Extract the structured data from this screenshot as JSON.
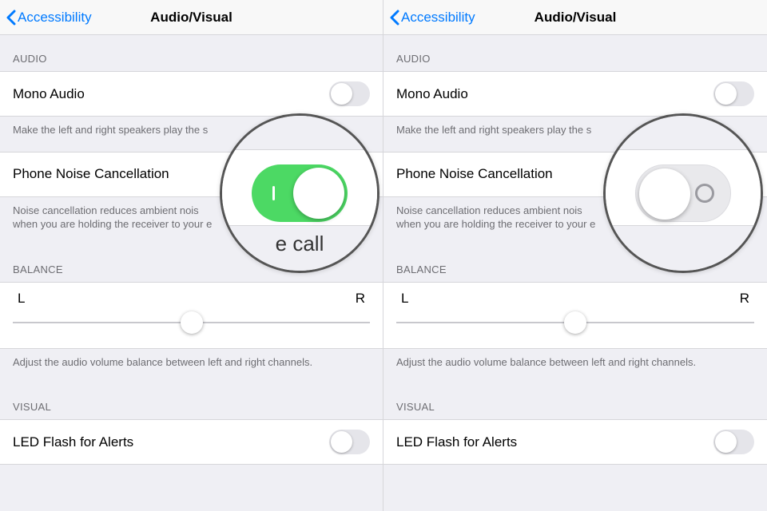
{
  "nav": {
    "back_label": "Accessibility",
    "title": "Audio/Visual"
  },
  "sections": {
    "audio_header": "AUDIO",
    "balance_header": "BALANCE",
    "visual_header": "VISUAL"
  },
  "rows": {
    "mono_audio": "Mono Audio",
    "phone_noise_cancellation": "Phone Noise Cancellation",
    "led_flash": "LED Flash for Alerts"
  },
  "footers": {
    "mono_audio_left": "Make the left and right speakers play the s",
    "noise_left_line1": "Noise cancellation reduces ambient nois",
    "noise_left_line2": "when you are holding the receiver to your e",
    "mono_audio_right": "Make the left and right speakers play the s",
    "noise_right_line1": "Noise cancellation reduces ambient nois",
    "noise_right_line2": "when you are holding the receiver to your e",
    "balance": "Adjust the audio volume balance between left and right channels."
  },
  "balance": {
    "left_label": "L",
    "right_label": "R",
    "value_percent": 50
  },
  "magnifier": {
    "partial_text": "e call"
  },
  "toggles": {
    "left": {
      "mono_audio": false,
      "phone_noise_cancellation": true,
      "led_flash": false
    },
    "right": {
      "mono_audio": false,
      "phone_noise_cancellation": false,
      "led_flash": false
    }
  }
}
